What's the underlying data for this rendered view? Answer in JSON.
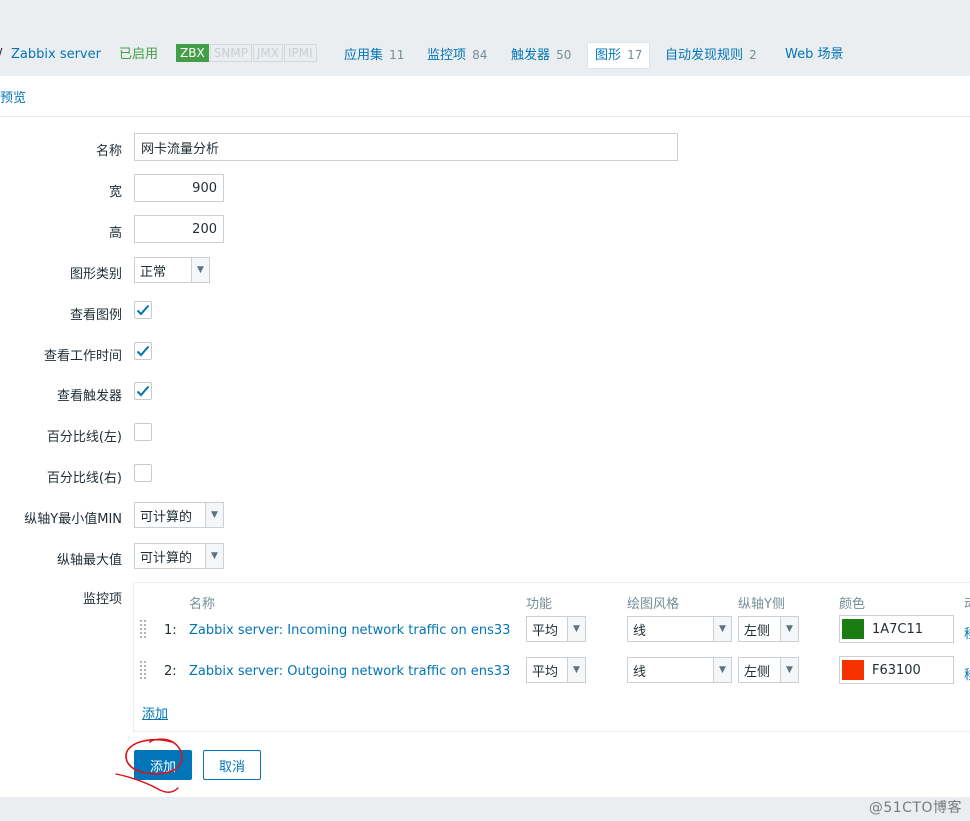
{
  "header": {
    "host_prefix": "/",
    "host": "Zabbix server",
    "status": "已启用",
    "availability": [
      "ZBX",
      "SNMP",
      "JMX",
      "IPMI"
    ],
    "tabs": [
      {
        "label": "应用集",
        "count": "11"
      },
      {
        "label": "监控项",
        "count": "84"
      },
      {
        "label": "触发器",
        "count": "50"
      },
      {
        "label": "图形",
        "count": "17"
      },
      {
        "label": "自动发现规则",
        "count": "2"
      },
      {
        "label": "Web 场景",
        "count": ""
      }
    ]
  },
  "form": {
    "preview_tab": "预览",
    "name_label": "名称",
    "name_value": "网卡流量分析",
    "width_label": "宽",
    "width_value": "900",
    "height_label": "高",
    "height_value": "200",
    "graph_type_label": "图形类别",
    "graph_type_value": "正常",
    "show_legend_label": "查看图例",
    "show_working_time_label": "查看工作时间",
    "show_triggers_label": "查看触发器",
    "percentile_left_label": "百分比线(左)",
    "percentile_right_label": "百分比线(右)",
    "ymin_label": "纵轴Y最小值MIN",
    "ymin_value": "可计算的",
    "ymax_label": "纵轴最大值",
    "ymax_value": "可计算的",
    "checkboxes": {
      "show_legend": true,
      "show_working_time": true,
      "show_triggers": true,
      "percentile_left": false,
      "percentile_right": false
    }
  },
  "items": {
    "label": "监控项",
    "columns": {
      "name": "名称",
      "function": "功能",
      "draw_style": "绘图风格",
      "y_axis": "纵轴Y侧",
      "color": "颜色",
      "action": "动"
    },
    "rows": [
      {
        "num": "1:",
        "name": "Zabbix server: Incoming network traffic on ens33",
        "function": "平均",
        "draw_style": "线",
        "y_axis": "左侧",
        "color": "1A7C11",
        "color_hex": "#1A7C11",
        "action": "移"
      },
      {
        "num": "2:",
        "name": "Zabbix server: Outgoing network traffic on ens33",
        "function": "平均",
        "draw_style": "线",
        "y_axis": "左侧",
        "color": "F63100",
        "color_hex": "#F63100",
        "action": "移"
      }
    ],
    "add_link": "添加"
  },
  "buttons": {
    "add": "添加",
    "cancel": "取消"
  },
  "watermark": "@51CTO博客"
}
